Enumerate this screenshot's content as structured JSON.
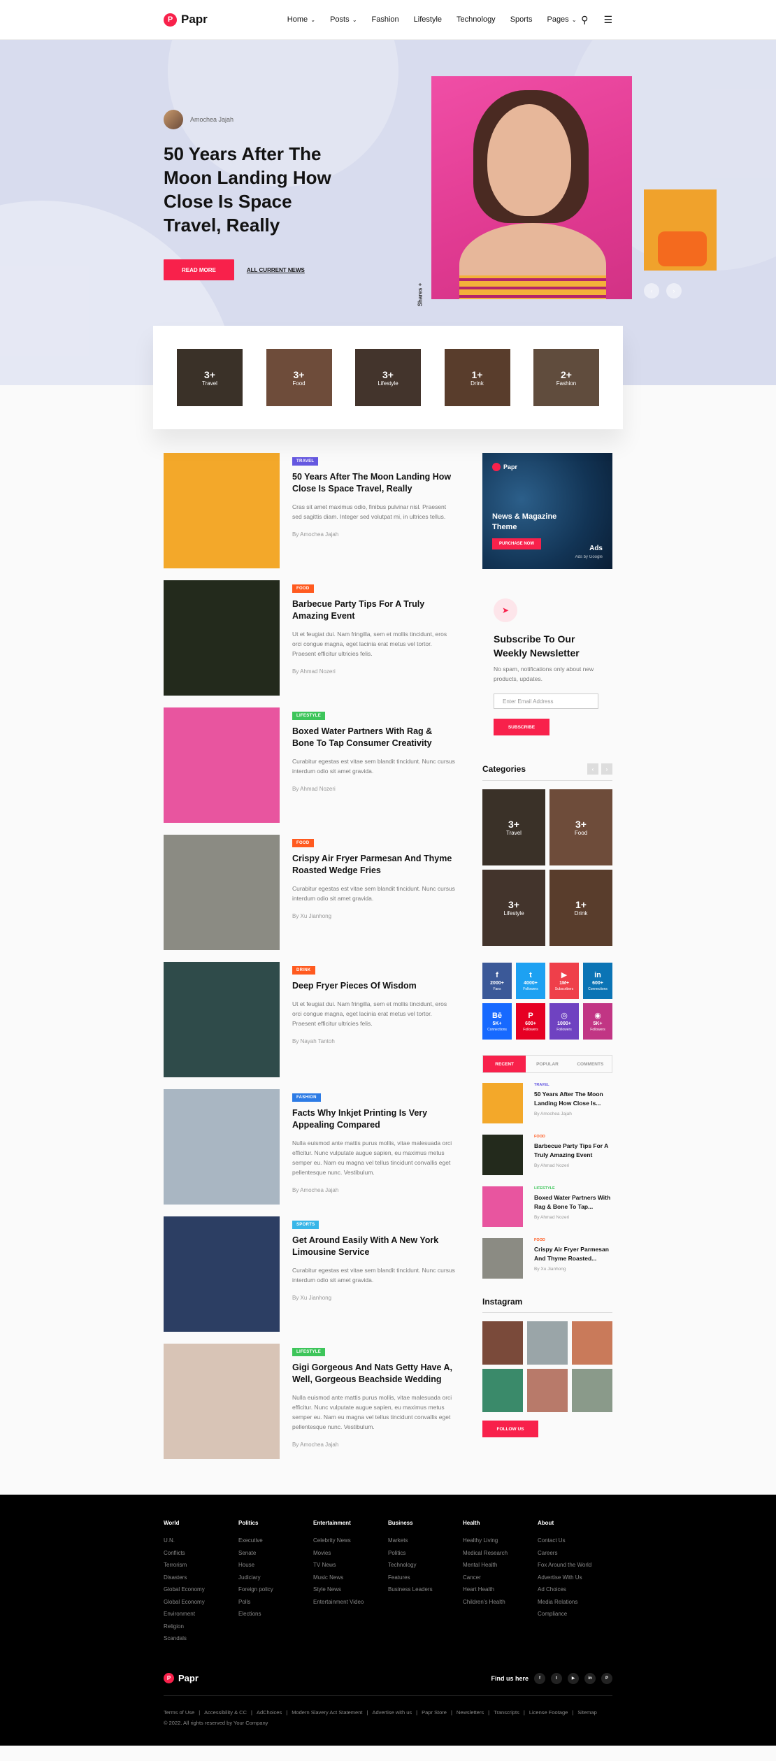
{
  "header": {
    "logo_text": "Papr",
    "logo_mark": "P",
    "nav": [
      {
        "label": "Home",
        "has_dropdown": true
      },
      {
        "label": "Posts",
        "has_dropdown": true
      },
      {
        "label": "Fashion",
        "has_dropdown": false
      },
      {
        "label": "Lifestyle",
        "has_dropdown": false
      },
      {
        "label": "Technology",
        "has_dropdown": false
      },
      {
        "label": "Sports",
        "has_dropdown": false
      },
      {
        "label": "Pages",
        "has_dropdown": true
      }
    ],
    "icons": [
      "search-icon",
      "menu-icon"
    ]
  },
  "hero": {
    "author": "Amochea Jajah",
    "title": "50 Years After The Moon Landing How Close Is Space Travel, Really",
    "read_more": "READ MORE",
    "all_news": "ALL CURRENT NEWS",
    "shares": "Shares",
    "shares_icon": "+"
  },
  "categories": [
    {
      "count": "3+",
      "label": "Travel",
      "color": "#6b5a4a"
    },
    {
      "count": "3+",
      "label": "Food",
      "color": "#c98a6a"
    },
    {
      "count": "3+",
      "label": "Lifestyle",
      "color": "#7a6050"
    },
    {
      "count": "1+",
      "label": "Drink",
      "color": "#a37050"
    },
    {
      "count": "2+",
      "label": "Fashion",
      "color": "#b08a70"
    }
  ],
  "posts": [
    {
      "badge": "TRAVEL",
      "badge_color": "#6558e0",
      "title": "50 Years After The Moon Landing How Close Is Space Travel, Really",
      "excerpt": "Cras sit amet maximus odio, finibus pulvinar nisl. Praesent sed sagittis diam. Integer sed volutpat mi, in ultrices tellus.",
      "author": "By Amochea Jajah",
      "thumb": "#f3a82a"
    },
    {
      "badge": "FOOD",
      "badge_color": "#ff5a1f",
      "title": "Barbecue Party Tips For A Truly Amazing Event",
      "excerpt": "Ut et feugiat dui. Nam fringilla, sem et mollis tincidunt, eros orci congue magna, eget lacinia erat metus vel tortor. Praesent efficitur ultricies felis.",
      "author": "By Ahmad Nozeri",
      "thumb": "#232a1c"
    },
    {
      "badge": "LIFESTYLE",
      "badge_color": "#3dc55a",
      "title": "Boxed Water Partners With Rag & Bone To Tap Consumer Creativity",
      "excerpt": "Curabitur egestas est vitae sem blandit tincidunt. Nunc cursus interdum odio sit amet gravida.",
      "author": "By Ahmad Nozeri",
      "thumb": "#e8559f"
    },
    {
      "badge": "FOOD",
      "badge_color": "#ff5a1f",
      "title": "Crispy Air Fryer Parmesan And Thyme Roasted Wedge Fries",
      "excerpt": "Curabitur egestas est vitae sem blandit tincidunt. Nunc cursus interdum odio sit amet gravida.",
      "author": "By Xu Jianhong",
      "thumb": "#8b8b83"
    },
    {
      "badge": "DRINK",
      "badge_color": "#ff5a1f",
      "title": "Deep Fryer Pieces Of Wisdom",
      "excerpt": "Ut et feugiat dui. Nam fringilla, sem et mollis tincidunt, eros orci congue magna, eget lacinia erat metus vel tortor. Praesent efficitur ultricies felis.",
      "author": "By Nayah Tantoh",
      "thumb": "#2f4b4a"
    },
    {
      "badge": "FASHION",
      "badge_color": "#2c7be5",
      "title": "Facts Why Inkjet Printing Is Very Appealing Compared",
      "excerpt": "Nulla euismod ante mattis purus mollis, vitae malesuada orci efficitur. Nunc vulputate augue sapien, eu maximus metus semper eu. Nam eu magna vel tellus tincidunt convallis eget pellentesque nunc. Vestibulum.",
      "author": "By Amochea Jajah",
      "thumb": "#a9b6c2"
    },
    {
      "badge": "SPORTS",
      "badge_color": "#38b6e8",
      "title": "Get Around Easily With A New York Limousine Service",
      "excerpt": "Curabitur egestas est vitae sem blandit tincidunt. Nunc cursus interdum odio sit amet gravida.",
      "author": "By Xu Jianhong",
      "thumb": "#2c3e63"
    },
    {
      "badge": "LIFESTYLE",
      "badge_color": "#3dc55a",
      "title": "Gigi Gorgeous And Nats Getty Have A, Well, Gorgeous Beachside Wedding",
      "excerpt": "Nulla euismod ante mattis purus mollis, vitae malesuada orci efficitur. Nunc vulputate augue sapien, eu maximus metus semper eu. Nam eu magna vel tellus tincidunt convallis eget pellentesque nunc. Vestibulum.",
      "author": "By Amochea Jajah",
      "thumb": "#d8c4b6"
    }
  ],
  "sidebar": {
    "ad": {
      "logo": "Papr",
      "title": "News & Magazine Theme",
      "button": "PURCHASE NOW",
      "label": "Ads",
      "sub": "Ads by Google"
    },
    "newsletter": {
      "title": "Subscribe To Our Weekly Newsletter",
      "text": "No spam, notifications only about new products, updates.",
      "placeholder": "Enter Email Address",
      "button": "SUBSCRIBE"
    },
    "categories_title": "Categories",
    "side_categories": [
      {
        "count": "3+",
        "label": "Travel",
        "color": "#6b5a4a"
      },
      {
        "count": "3+",
        "label": "Food",
        "color": "#c98a6a"
      },
      {
        "count": "3+",
        "label": "Lifestyle",
        "color": "#7a6050"
      },
      {
        "count": "1+",
        "label": "Drink",
        "color": "#a37050"
      }
    ],
    "social": [
      {
        "icon": "f",
        "count": "2000+",
        "label": "Fans",
        "color": "#3b5998"
      },
      {
        "icon": "t",
        "count": "4000+",
        "label": "Followers",
        "color": "#1da1f2"
      },
      {
        "icon": "▶",
        "count": "1M+",
        "label": "Subscribers",
        "color": "#ef3f4a"
      },
      {
        "icon": "in",
        "count": "600+",
        "label": "Connections",
        "color": "#0b74b5"
      },
      {
        "icon": "Bē",
        "count": "5K+",
        "label": "Connections",
        "color": "#1769ff"
      },
      {
        "icon": "P",
        "count": "600+",
        "label": "Followers",
        "color": "#e60023"
      },
      {
        "icon": "◎",
        "count": "1000+",
        "label": "Followers",
        "color": "#6f42c1"
      },
      {
        "icon": "◉",
        "count": "5K+",
        "label": "Followers",
        "color": "#c13584"
      }
    ],
    "tabs": [
      "RECENT",
      "POPULAR",
      "COMMENTS"
    ],
    "recent": [
      {
        "cat": "TRAVEL",
        "cat_color": "#6558e0",
        "title": "50 Years After The Moon Landing How Close Is...",
        "by": "By Amochea Jajah",
        "thumb": "#f3a82a"
      },
      {
        "cat": "FOOD",
        "cat_color": "#ff5a1f",
        "title": "Barbecue Party Tips For A Truly Amazing Event",
        "by": "By Ahmad Nozeri",
        "thumb": "#232a1c"
      },
      {
        "cat": "LIFESTYLE",
        "cat_color": "#3dc55a",
        "title": "Boxed Water Partners With Rag & Bone To Tap...",
        "by": "By Ahmad Nozeri",
        "thumb": "#e8559f"
      },
      {
        "cat": "FOOD",
        "cat_color": "#ff5a1f",
        "title": "Crispy Air Fryer Parmesan And Thyme Roasted...",
        "by": "By Xu Jianhong",
        "thumb": "#8b8b83"
      }
    ],
    "instagram_title": "Instagram",
    "instagram": [
      "#7a4a3a",
      "#9aa5a8",
      "#c97a5a",
      "#3a8a6a",
      "#b87a6a",
      "#8a9a8a"
    ],
    "follow": "FOLLOW US"
  },
  "footer": {
    "columns": [
      {
        "title": "World",
        "links": [
          "U.N.",
          "Conflicts",
          "Terrorism",
          "Disasters",
          "Global Economy",
          "Global Economy",
          "Environment",
          "Religion",
          "Scandals"
        ]
      },
      {
        "title": "Politics",
        "links": [
          "Executive",
          "Senate",
          "House",
          "Judiciary",
          "Foreign policy",
          "Polls",
          "Elections"
        ]
      },
      {
        "title": "Entertainment",
        "links": [
          "Celebrity News",
          "Movies",
          "TV News",
          "Music News",
          "Style News",
          "Entertainment Video"
        ]
      },
      {
        "title": "Business",
        "links": [
          "Markets",
          "Politics",
          "Technology",
          "Features",
          "Business Leaders"
        ]
      },
      {
        "title": "Health",
        "links": [
          "Healthy Living",
          "Medical Research",
          "Mental Health",
          "Cancer",
          "Heart Health",
          "Children's Health"
        ]
      },
      {
        "title": "About",
        "links": [
          "Contact Us",
          "Careers",
          "Fox Around the World",
          "Advertise With Us",
          "Ad Choices",
          "Media Relations",
          "Compliance"
        ]
      }
    ],
    "logo": "Papr",
    "find_us": "Find us here",
    "links": [
      "Terms of Use",
      "Accessibility & CC",
      "AdChoices",
      "Modern Slavery Act Statement",
      "Advertise with us",
      "Papr Store",
      "Newsletters",
      "Transcripts",
      "License Footage",
      "Sitemap"
    ],
    "copyright": "© 2022. All rights reserved by Your Company"
  }
}
